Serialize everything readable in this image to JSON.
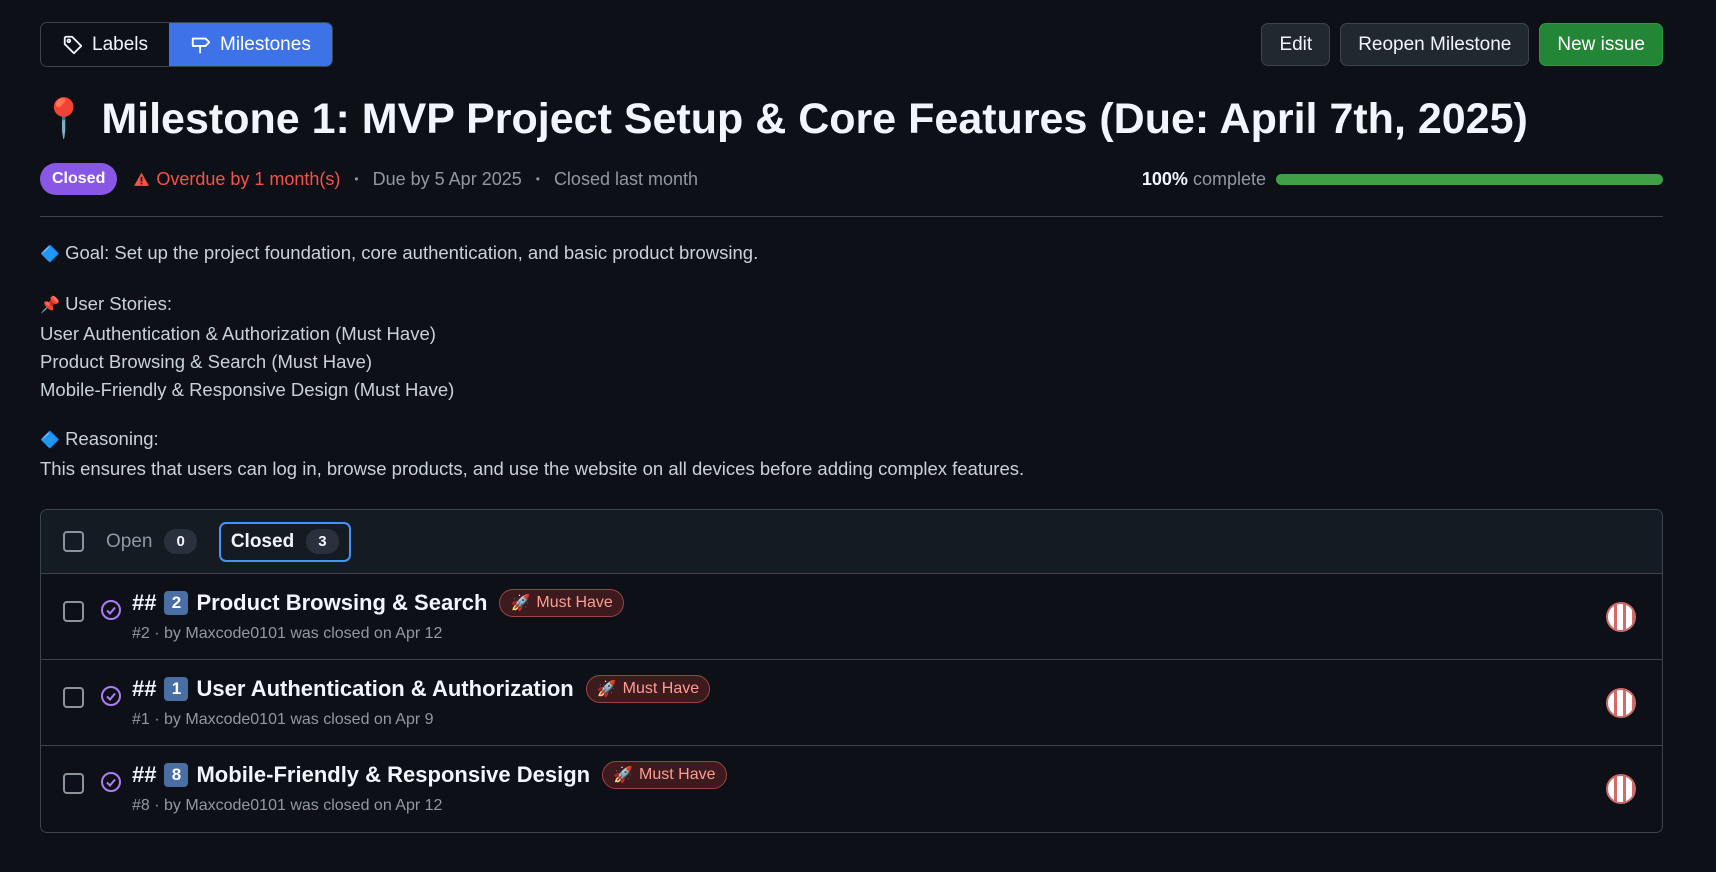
{
  "nav": {
    "labels": "Labels",
    "milestones": "Milestones"
  },
  "actions": {
    "edit": "Edit",
    "reopen": "Reopen Milestone",
    "new_issue": "New issue"
  },
  "milestone": {
    "pin_emoji": "📍",
    "title": "Milestone 1: MVP Project Setup & Core Features (Due: April 7th, 2025)",
    "status": "Closed",
    "overdue": "Overdue by 1 month(s)",
    "due": "Due by 5 Apr 2025",
    "closed": "Closed last month",
    "percent": "100%",
    "complete_word": "complete",
    "progress_fraction": 1.0
  },
  "description": {
    "goal": "Goal: Set up the project foundation, core authentication, and basic product browsing.",
    "stories_heading": "User Stories:",
    "stories": [
      "User Authentication & Authorization (Must Have)",
      "Product Browsing & Search (Must Have)",
      "Mobile-Friendly & Responsive Design (Must Have)"
    ],
    "reasoning_heading": "Reasoning:",
    "reasoning": "This ensures that users can log in, browse products, and use the website on all devices before adding complex features."
  },
  "issues_panel": {
    "open_label": "Open",
    "open_count": "0",
    "closed_label": "Closed",
    "closed_count": "3",
    "issues": [
      {
        "prefix": "##",
        "num_emoji": "2",
        "title": "Product Browsing & Search",
        "label": "Must Have",
        "meta": "#2 · by Maxcode0101 was closed on Apr 12"
      },
      {
        "prefix": "##",
        "num_emoji": "1",
        "title": "User Authentication & Authorization",
        "label": "Must Have",
        "meta": "#1 · by Maxcode0101 was closed on Apr 9"
      },
      {
        "prefix": "##",
        "num_emoji": "8",
        "title": "Mobile-Friendly & Responsive Design",
        "label": "Must Have",
        "meta": "#8 · by Maxcode0101 was closed on Apr 12"
      }
    ]
  },
  "colors": {
    "accent_blue": "#3d73e6",
    "primary_green": "#238636",
    "closed_purple": "#8957e5",
    "overdue_red": "#f85149"
  }
}
